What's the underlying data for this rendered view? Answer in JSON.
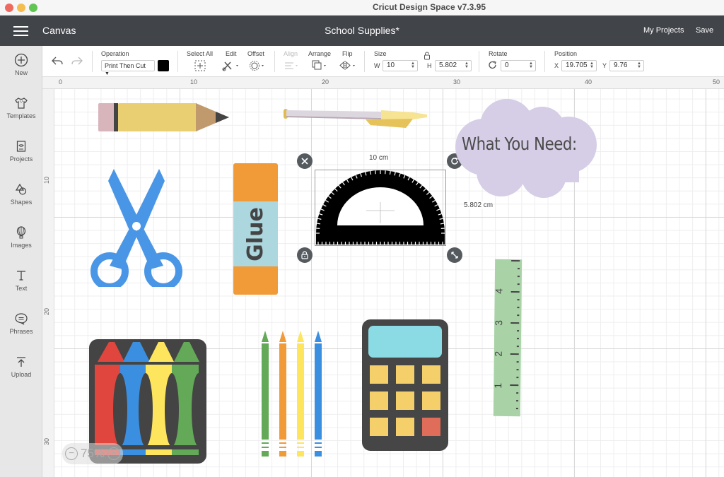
{
  "window": {
    "title": "Cricut Design Space  v7.3.95"
  },
  "appbar": {
    "section": "Canvas",
    "project_title": "School Supplies*",
    "my_projects": "My Projects",
    "save": "Save"
  },
  "sidebar": {
    "items": [
      {
        "label": "New",
        "icon": "plus-circle-icon"
      },
      {
        "label": "Templates",
        "icon": "shirt-icon"
      },
      {
        "label": "Projects",
        "icon": "projects-icon"
      },
      {
        "label": "Shapes",
        "icon": "shapes-icon"
      },
      {
        "label": "Images",
        "icon": "balloon-icon"
      },
      {
        "label": "Text",
        "icon": "text-icon"
      },
      {
        "label": "Phrases",
        "icon": "speech-bubble-icon"
      },
      {
        "label": "Upload",
        "icon": "upload-icon"
      }
    ]
  },
  "toolbar": {
    "operation_label": "Operation",
    "operation_value": "Print Then Cut",
    "operation_color": "#000000",
    "select_all": "Select All",
    "edit": "Edit",
    "offset": "Offset",
    "align": "Align",
    "arrange": "Arrange",
    "flip": "Flip",
    "size_label": "Size",
    "w_label": "W",
    "w_value": "10",
    "h_label": "H",
    "h_value": "5.802",
    "rotate_label": "Rotate",
    "rotate_value": "0",
    "position_label": "Position",
    "x_label": "X",
    "x_value": "19.705",
    "y_label": "Y",
    "y_value": "9.76"
  },
  "rulers": {
    "top": [
      "0",
      "10",
      "20",
      "30",
      "40",
      "50"
    ],
    "left": [
      "10",
      "20",
      "30"
    ]
  },
  "canvas": {
    "selection": {
      "width_label": "10 cm",
      "height_label": "5.802 cm"
    },
    "cloud_text": "What You Need:",
    "glue_text": "Glue",
    "ruler_numbers": [
      "1",
      "2",
      "3",
      "4"
    ],
    "zoom_level": "75%"
  },
  "colors": {
    "appbar": "#414449",
    "scissors": "#4a96e6",
    "glue_orange": "#f09a38",
    "glue_label": "#acd7df",
    "cloud": "#d6cde6",
    "ruler_green": "#a9d3a7",
    "calc_screen": "#8adbe3",
    "calc_key": "#f5cf6a",
    "calc_red": "#e06c5a"
  }
}
